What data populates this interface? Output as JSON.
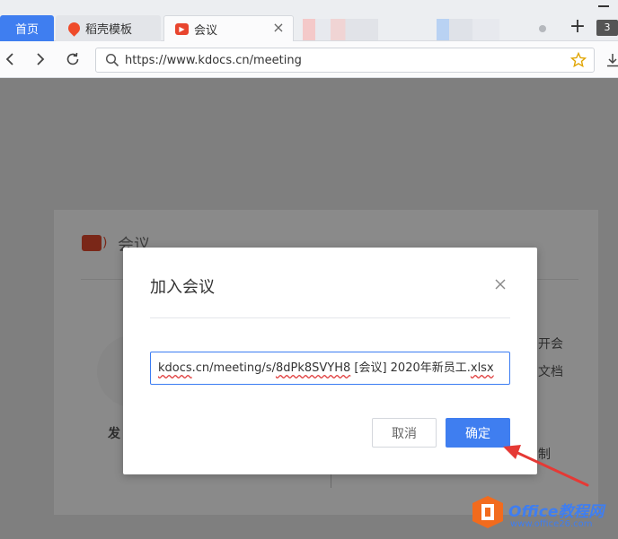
{
  "browser": {
    "tabs": [
      {
        "label": "首页"
      },
      {
        "label": "稻壳模板"
      },
      {
        "label": "会议"
      }
    ],
    "tab_count": "3",
    "new_tab": "+",
    "url": "https://www.kdocs.cn/meeting"
  },
  "page": {
    "title": "会议",
    "left_label": "发",
    "right_items": [
      "开会",
      "文档",
      "制"
    ]
  },
  "dialog": {
    "title": "加入会议",
    "input_value": "kdocs.cn/meeting/s/8dPk8SVYH8 [会议] 2020年新员工.xlsx",
    "input_parts": {
      "a": "kdocs",
      "b": ".cn/meeting/s/",
      "c": "8dPk8SVYH8",
      "d": " [会议] 2020年新员工.",
      "e": "xlsx"
    },
    "cancel_label": "取消",
    "confirm_label": "确定"
  },
  "watermark": {
    "title": "Office教程网",
    "url": "www.office26.com"
  },
  "colors": {
    "accent": "#3f7ef0",
    "annotation_arrow": "#e53935",
    "overlay": "#7f7f7f"
  }
}
